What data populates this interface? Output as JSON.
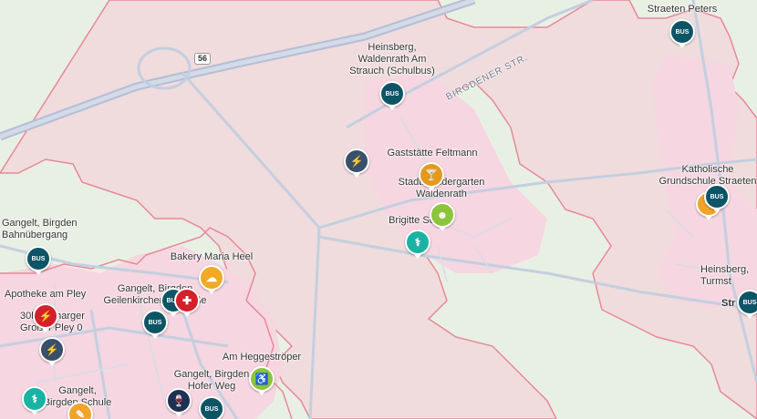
{
  "colors": {
    "background": "#e8f0e4",
    "zone_fill": "#f0dcdc",
    "zone_border": "#e8889a",
    "urban_fill": "#f6d6e0",
    "road": "#c3cfe0",
    "highway": "#b3bdd6"
  },
  "road_shield": "56",
  "road_name": "BIRGDENER STR.",
  "labels": {
    "heinsberg_waldenrath": "Heinsberg,\nWaldenrath Am\nStrauch (Schulbus)",
    "straeten_peters": "Straeten Peters",
    "gaststaette": "Gaststätte Feltmann",
    "kindergarten": "Stadt. Kindergarten\nWaldenrath",
    "brigitte": "Brigitte Sentis",
    "katholische": "Katholische\nGrundschule Straeten",
    "heinsberg_turmst": "Heinsberg,\nTurmst",
    "str": "Str",
    "birgden_bahn": "Gangelt, Birgden\nBahnübergang",
    "bakery": "Bakery Maria Heel",
    "apotheke": "Apotheke am Pley",
    "geilenkirchener": "Gangelt, Birgden\nGeilenkirchener Straße",
    "charger": "30kW Charger\nGroßer Pley 0",
    "heggestroeper": "Am Heggeströper",
    "hofer_weg": "Gangelt, Birgden\nHofer Weg",
    "birgden_schule": "Gangelt,\nBirgden Schule"
  },
  "markers": [
    {
      "name": "bus-stop-waldenrath",
      "kind": "bus",
      "icon": "bus-icon",
      "text": "BUS"
    },
    {
      "name": "bus-stop-straeten-peters",
      "kind": "bus",
      "icon": "bus-icon",
      "text": "BUS"
    },
    {
      "name": "charging-station-north",
      "kind": "charge",
      "icon": "lightning-icon",
      "text": "⚡"
    },
    {
      "name": "pub-gaststaette",
      "kind": "bar",
      "icon": "cocktail-icon",
      "text": "🍸"
    },
    {
      "name": "kindergarten-waldenrath",
      "kind": "kids",
      "icon": "child-icon",
      "text": "☻"
    },
    {
      "name": "doctor-brigitte",
      "kind": "doctor",
      "icon": "stethoscope-icon",
      "text": "⚕"
    },
    {
      "name": "school-katholische",
      "kind": "school",
      "icon": "school-icon",
      "text": "✎"
    },
    {
      "name": "bus-stop-katholische",
      "kind": "bus",
      "icon": "bus-icon",
      "text": "BUS"
    },
    {
      "name": "bus-stop-turmst",
      "kind": "bus",
      "icon": "bus-icon",
      "text": "BUS"
    },
    {
      "name": "bus-stop-bahnuebergang",
      "kind": "bus",
      "icon": "bus-icon",
      "text": "BUS"
    },
    {
      "name": "bakery-maria-heel",
      "kind": "bakery",
      "icon": "bread-icon",
      "text": "☁"
    },
    {
      "name": "bus-stop-geilenkirchener",
      "kind": "bus",
      "icon": "bus-icon",
      "text": "BUS"
    },
    {
      "name": "pharmacy-apotheke",
      "kind": "pharmacy",
      "icon": "pharmacy-icon",
      "text": "✚"
    },
    {
      "name": "charger-grosser-pley",
      "kind": "pharmacy",
      "icon": "charger-icon",
      "text": "⚡"
    },
    {
      "name": "charging-station-west",
      "kind": "charge",
      "icon": "lightning-icon",
      "text": "⚡"
    },
    {
      "name": "bus-stop-pley",
      "kind": "bus",
      "icon": "bus-icon",
      "text": "BUS"
    },
    {
      "name": "care-heggestroeper",
      "kind": "care",
      "icon": "wheelchair-icon",
      "text": "♿"
    },
    {
      "name": "wine-shop-hofer",
      "kind": "dark",
      "icon": "wine-icon",
      "text": "🍷"
    },
    {
      "name": "bus-stop-hofer-weg",
      "kind": "bus",
      "icon": "bus-icon",
      "text": "BUS"
    },
    {
      "name": "doctor-birgden-schule",
      "kind": "doctor",
      "icon": "stethoscope-icon",
      "text": "⚕"
    },
    {
      "name": "school-birgden",
      "kind": "school",
      "icon": "school-icon",
      "text": "✎"
    }
  ]
}
